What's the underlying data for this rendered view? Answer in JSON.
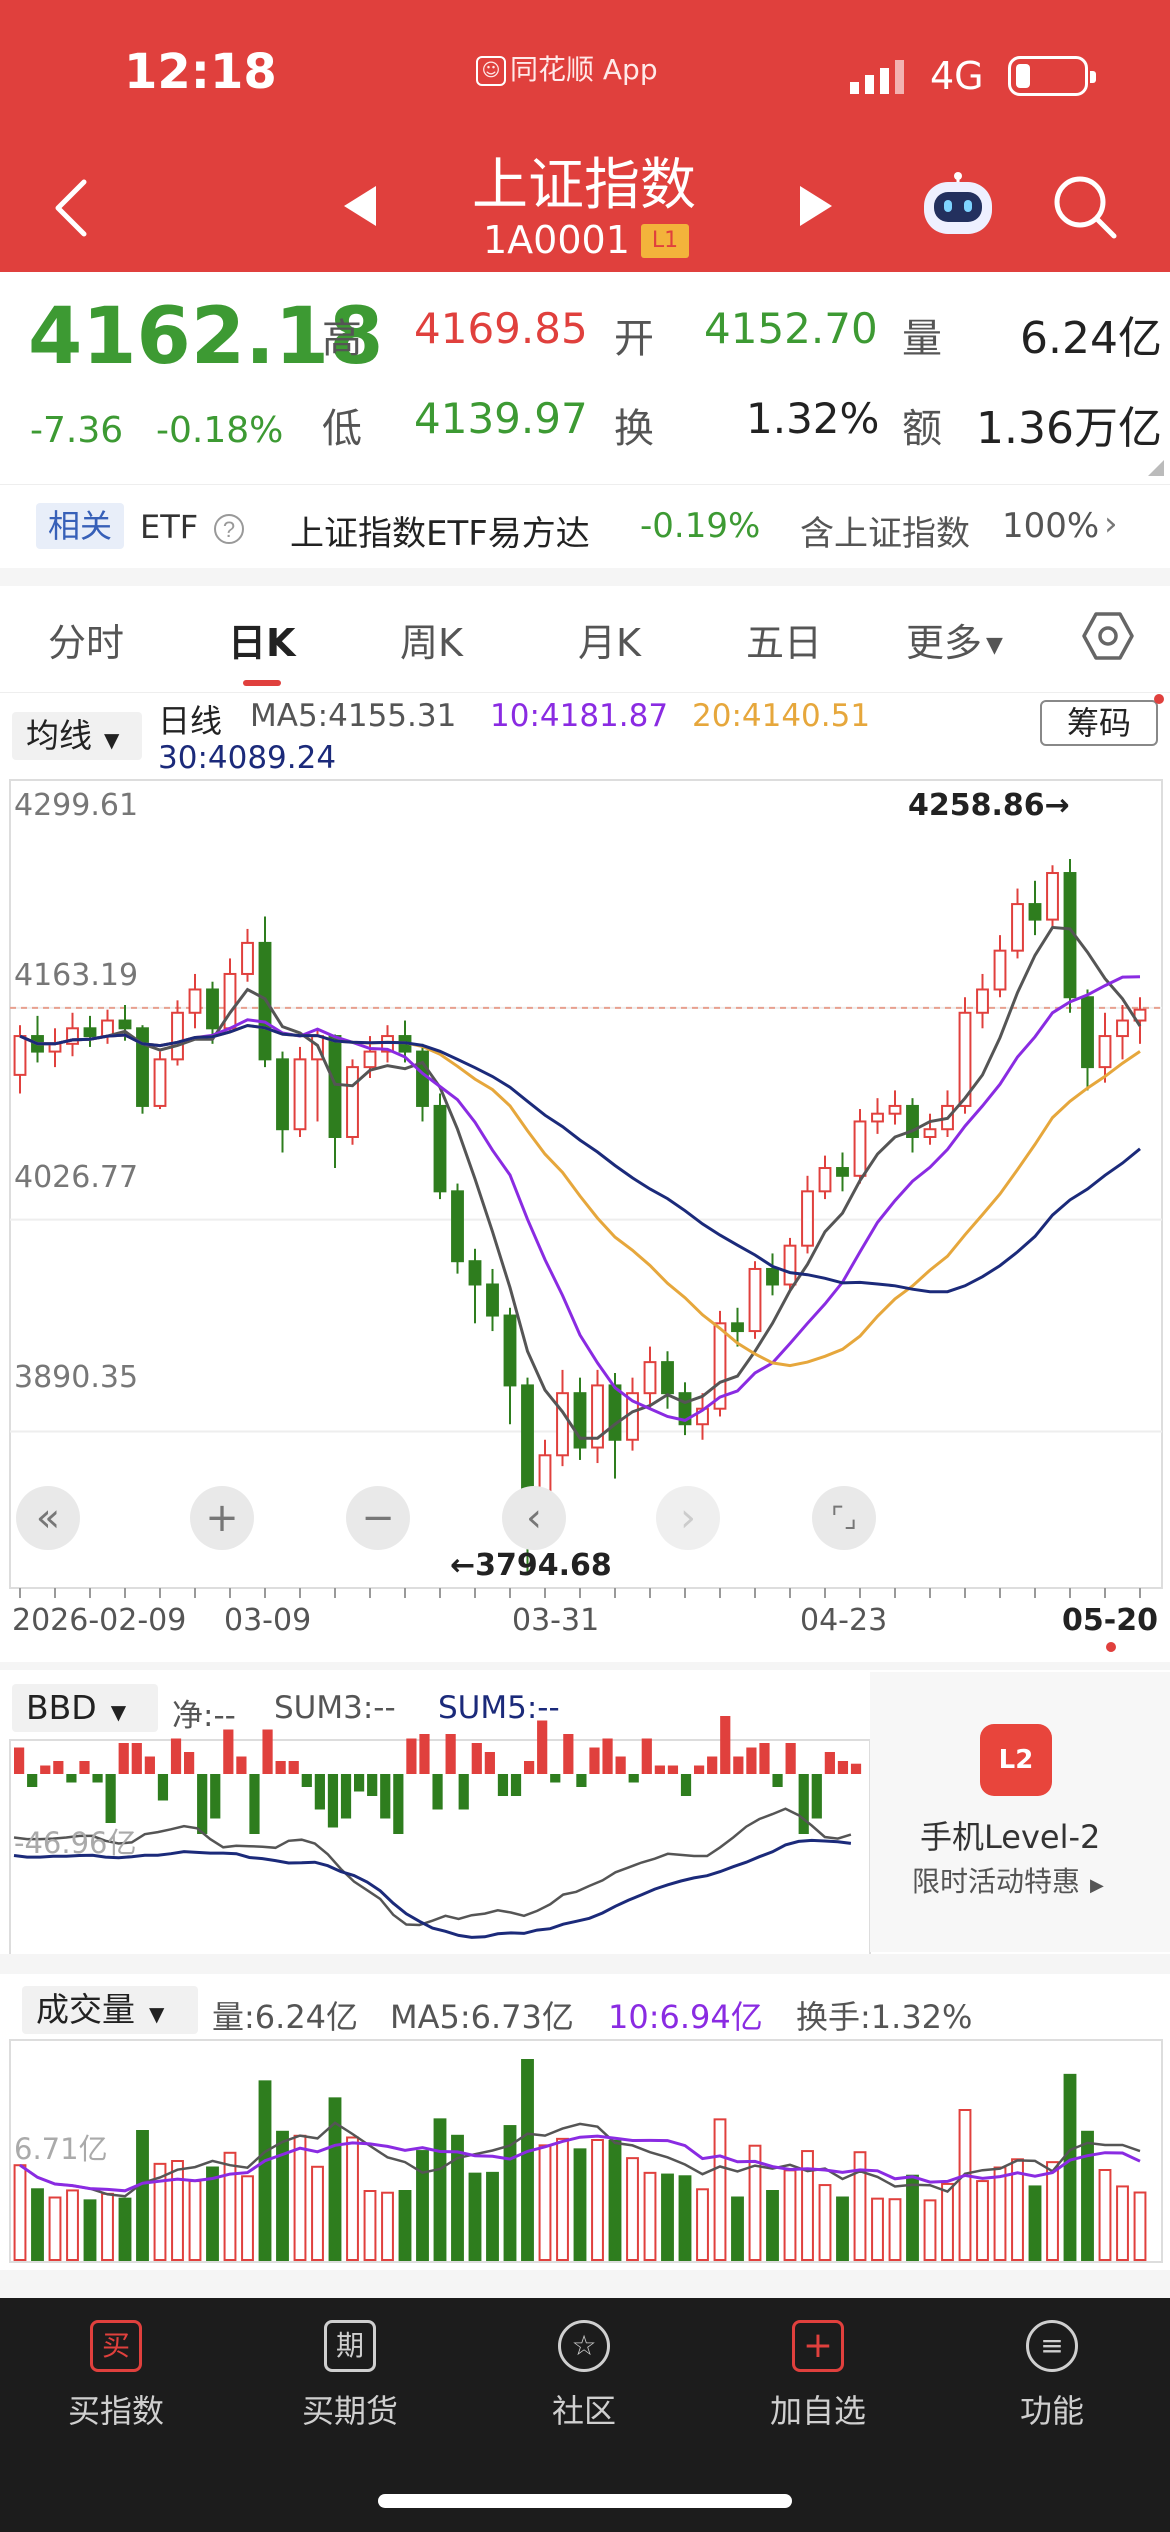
{
  "status_bar": {
    "time": "12:18",
    "app_label": "同花顺 App",
    "network": "4G"
  },
  "header": {
    "title": "上证指数",
    "code": "1A0001",
    "badge": "L1"
  },
  "quote": {
    "price": "4162.18",
    "change": "-7.36",
    "change_pct": "-0.18%",
    "high_label": "高",
    "high": "4169.85",
    "open_label": "开",
    "open": "4152.70",
    "volume_label": "量",
    "volume": "6.24亿",
    "low_label": "低",
    "low": "4139.97",
    "turnover_label": "换",
    "turnover": "1.32%",
    "amount_label": "额",
    "amount": "1.36万亿"
  },
  "related": {
    "tag": "相关",
    "etf": "ETF",
    "fund_name": "上证指数ETF易方达",
    "fund_change": "-0.19%",
    "holding_label": "含上证指数",
    "holding_pct": "100%"
  },
  "tabs": [
    "分时",
    "日K",
    "周K",
    "月K",
    "五日",
    "更多"
  ],
  "active_tab": "日K",
  "kline": {
    "indicator_select": "均线",
    "period_label": "日线",
    "ma5": "MA5:4155.31",
    "ma10": "10:4181.87",
    "ma20": "20:4140.51",
    "ma30": "30:4089.24",
    "chip_button": "筹码",
    "y_labels": [
      "4299.61",
      "4163.19",
      "4026.77",
      "3890.35"
    ],
    "high_marker": "4258.86→",
    "low_marker": "←3794.68",
    "x_labels": [
      "2026-02-09",
      "03-09",
      "03-31",
      "04-23",
      "05-20"
    ],
    "controls": [
      "«",
      "+",
      "−",
      "‹",
      "›",
      "⌜⌟"
    ]
  },
  "bbd": {
    "select": "BBD",
    "net": "净:--",
    "sum3": "SUM3:--",
    "sum5": "SUM5:--",
    "axis_label": "-46.96亿"
  },
  "level2_promo": {
    "logo": "L2",
    "title": "手机Level-2",
    "subtitle": "限时活动特惠"
  },
  "volume_panel": {
    "select": "成交量",
    "vol": "量:6.24亿",
    "ma5": "MA5:6.73亿",
    "ma10": "10:6.94亿",
    "turnover": "换手:1.32%",
    "axis_label": "6.71亿"
  },
  "bottom_nav": [
    {
      "icon": "买",
      "label": "买指数"
    },
    {
      "icon": "期",
      "label": "买期货"
    },
    {
      "icon": "☆",
      "label": "社区"
    },
    {
      "icon": "+",
      "label": "加自选"
    },
    {
      "icon": "≡",
      "label": "功能"
    }
  ],
  "colors": {
    "up": "#e0403d",
    "down": "#2e7d1e",
    "header": "#e0403d",
    "ma5": "#555555",
    "ma10": "#8a2be2",
    "ma20": "#e6a73c",
    "ma30": "#1b2a7a"
  },
  "chart_data": {
    "type": "candlestick",
    "y_range": [
      3794.68,
      4299.61
    ],
    "reference_price": 4163.19,
    "x_ticks": [
      "2026-02-09",
      "03-09",
      "03-31",
      "04-23",
      "05-20"
    ],
    "candles": [
      [
        4120,
        4145,
        4152,
        4108
      ],
      [
        4145,
        4135,
        4158,
        4128
      ],
      [
        4135,
        4140,
        4150,
        4125
      ],
      [
        4140,
        4150,
        4160,
        4132
      ],
      [
        4150,
        4145,
        4158,
        4138
      ],
      [
        4145,
        4155,
        4162,
        4140
      ],
      [
        4155,
        4150,
        4165,
        4142
      ],
      [
        4150,
        4100,
        4152,
        4095
      ],
      [
        4100,
        4130,
        4135,
        4098
      ],
      [
        4130,
        4160,
        4168,
        4126
      ],
      [
        4160,
        4175,
        4185,
        4150
      ],
      [
        4175,
        4150,
        4180,
        4140
      ],
      [
        4150,
        4185,
        4195,
        4148
      ],
      [
        4185,
        4205,
        4214,
        4180
      ],
      [
        4205,
        4130,
        4222,
        4125
      ],
      [
        4130,
        4085,
        4135,
        4070
      ],
      [
        4085,
        4130,
        4138,
        4080
      ],
      [
        4130,
        4145,
        4150,
        4090
      ],
      [
        4145,
        4080,
        4146,
        4060
      ],
      [
        4080,
        4125,
        4130,
        4075
      ],
      [
        4125,
        4135,
        4145,
        4118
      ],
      [
        4135,
        4145,
        4152,
        4128
      ],
      [
        4145,
        4135,
        4155,
        4128
      ],
      [
        4135,
        4100,
        4140,
        4090
      ],
      [
        4100,
        4045,
        4108,
        4040
      ],
      [
        4045,
        4000,
        4050,
        3992
      ],
      [
        4000,
        3985,
        4008,
        3960
      ],
      [
        3985,
        3965,
        3995,
        3955
      ],
      [
        3965,
        3920,
        3970,
        3895
      ],
      [
        3920,
        3840,
        3925,
        3800
      ],
      [
        3840,
        3875,
        3885,
        3825
      ],
      [
        3875,
        3915,
        3930,
        3868
      ],
      [
        3915,
        3880,
        3925,
        3872
      ],
      [
        3880,
        3920,
        3930,
        3870
      ],
      [
        3920,
        3885,
        3928,
        3860
      ],
      [
        3885,
        3915,
        3925,
        3878
      ],
      [
        3915,
        3935,
        3945,
        3905
      ],
      [
        3935,
        3915,
        3942,
        3905
      ],
      [
        3915,
        3895,
        3922,
        3888
      ],
      [
        3895,
        3905,
        3915,
        3885
      ],
      [
        3905,
        3960,
        3968,
        3900
      ],
      [
        3960,
        3955,
        3970,
        3945
      ],
      [
        3955,
        3995,
        4000,
        3950
      ],
      [
        3995,
        3985,
        4005,
        3978
      ],
      [
        3985,
        4010,
        4015,
        3980
      ],
      [
        4010,
        4045,
        4055,
        4005
      ],
      [
        4045,
        4060,
        4068,
        4040
      ],
      [
        4060,
        4055,
        4070,
        4045
      ],
      [
        4055,
        4090,
        4098,
        4050
      ],
      [
        4090,
        4095,
        4105,
        4082
      ],
      [
        4095,
        4100,
        4110,
        4088
      ],
      [
        4100,
        4080,
        4105,
        4070
      ],
      [
        4080,
        4085,
        4095,
        4075
      ],
      [
        4085,
        4100,
        4110,
        4080
      ],
      [
        4100,
        4160,
        4170,
        4095
      ],
      [
        4160,
        4175,
        4185,
        4150
      ],
      [
        4175,
        4200,
        4210,
        4170
      ],
      [
        4200,
        4230,
        4240,
        4195
      ],
      [
        4230,
        4220,
        4245,
        4210
      ],
      [
        4220,
        4250,
        4255,
        4215
      ],
      [
        4250,
        4170,
        4259,
        4160
      ],
      [
        4170,
        4125,
        4175,
        4110
      ],
      [
        4125,
        4145,
        4160,
        4115
      ],
      [
        4145,
        4155,
        4165,
        4130
      ],
      [
        4155,
        4162,
        4170,
        4140
      ]
    ]
  }
}
